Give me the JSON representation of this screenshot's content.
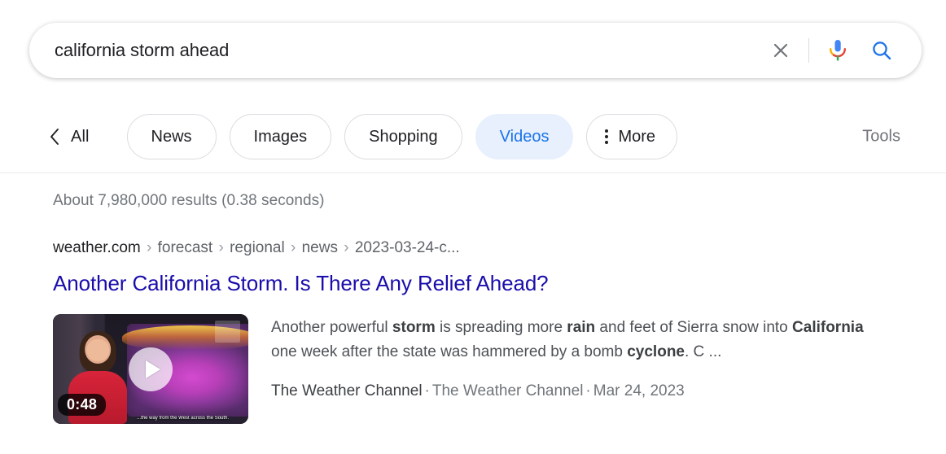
{
  "search": {
    "query": "california storm ahead",
    "placeholder": "Search",
    "clear_icon": "close-icon",
    "mic_icon": "microphone-icon",
    "search_icon": "magnifier-icon"
  },
  "nav": {
    "back_label": "All",
    "tabs": [
      {
        "label": "News",
        "selected": false
      },
      {
        "label": "Images",
        "selected": false
      },
      {
        "label": "Shopping",
        "selected": false
      },
      {
        "label": "Videos",
        "selected": true
      },
      {
        "label": "More",
        "selected": false
      }
    ],
    "tools_label": "Tools",
    "selected_color": "#e8f0fe",
    "selected_text_color": "#1a73e8"
  },
  "results": {
    "stats": "About 7,980,000 results (0.38 seconds)",
    "items": [
      {
        "breadcrumb": {
          "site": "weather.com",
          "path": [
            "forecast",
            "regional",
            "news",
            "2023-03-24-c..."
          ],
          "separator": "›"
        },
        "title": "Another California Storm. Is There Any Relief Ahead?",
        "title_color": "#1a0dab",
        "snippet": {
          "line1_pre": "Another powerful ",
          "b1": "storm",
          "line1_mid": " is spreading more ",
          "b2": "rain",
          "line1_post": " and feet of Sierra snow into",
          "b3": "California",
          "line2_mid": " one week after the state was hammered by a bomb ",
          "b4": "cyclone",
          "line2_post": ". C ..."
        },
        "video": {
          "duration": "0:48",
          "caption": "...the way from the West across the South.",
          "play_icon": "play-icon"
        },
        "meta": {
          "channel": "The Weather Channel",
          "source": "The Weather Channel",
          "date": "Mar 24, 2023",
          "separator": "·"
        }
      }
    ]
  }
}
